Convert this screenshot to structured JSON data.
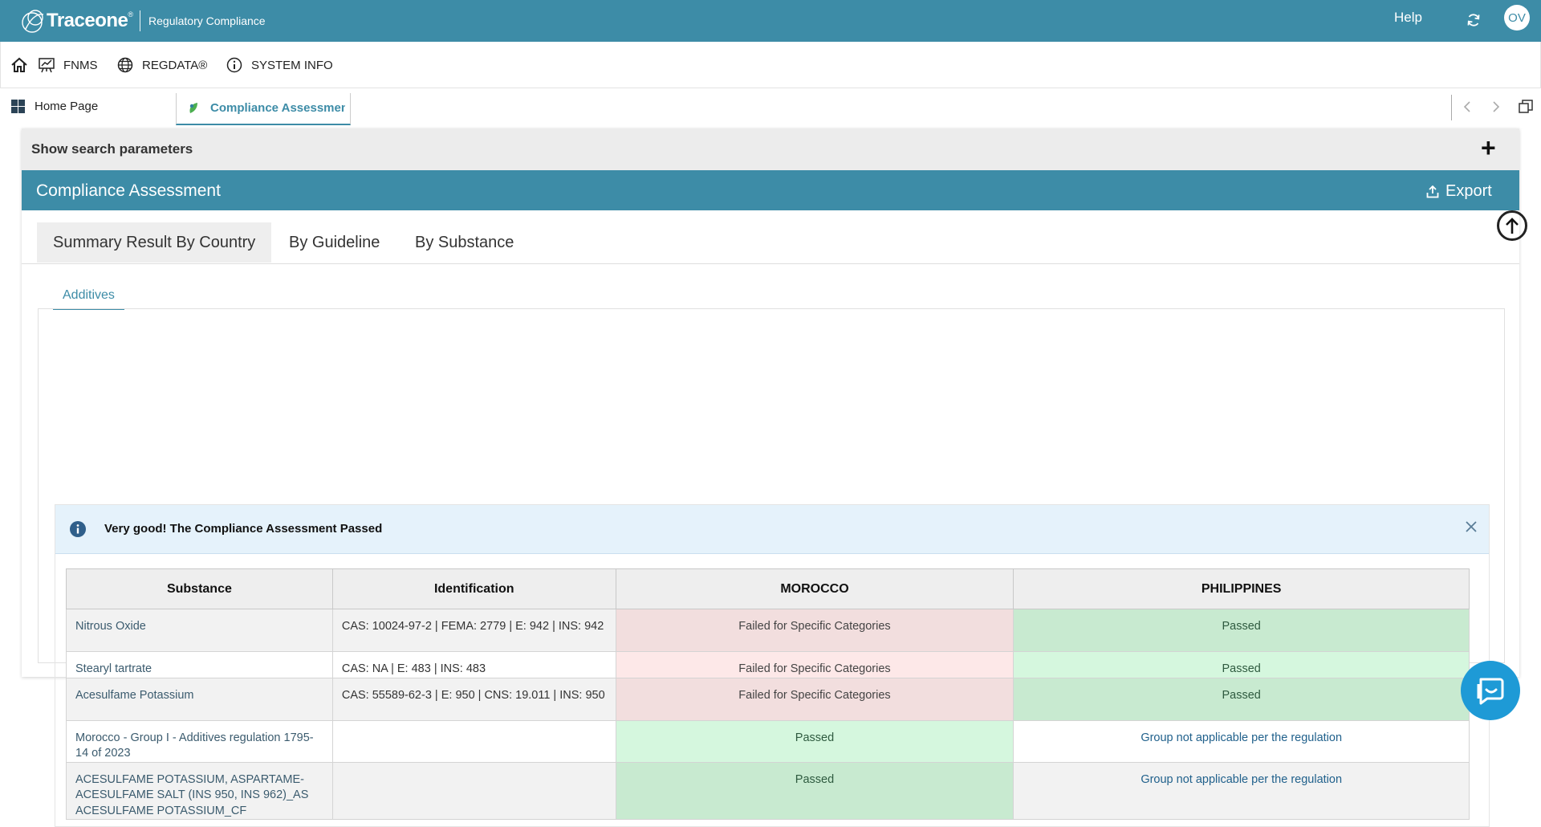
{
  "topbar": {
    "brand": "Traceone",
    "brand_reg": "®",
    "app_name": "Regulatory Compliance",
    "help": "Help",
    "avatar": "OV",
    "bg_color": "#3d8ca7"
  },
  "nav": {
    "items": [
      {
        "label": "FNMS",
        "icon": "presentation-chart-icon"
      },
      {
        "label": "REGDATA®",
        "icon": "globe-icon"
      },
      {
        "label": "SYSTEM INFO",
        "icon": "info-icon"
      }
    ]
  },
  "tabs_bar": {
    "home": "Home Page",
    "active": "Compliance Assessment"
  },
  "panel": {
    "search_params": "Show search parameters",
    "title": "Compliance Assessment",
    "export": "Export",
    "tabs": [
      "Summary Result By Country",
      "By Guideline",
      "By Substance"
    ],
    "active_tab": "Summary Result By Country",
    "subtab": "Additives",
    "alert": "Very good! The Compliance Assessment Passed"
  },
  "table": {
    "headers": [
      "Substance",
      "Identification",
      "MOROCCO",
      "PHILIPPINES"
    ],
    "rows": [
      {
        "substance": "Nitrous Oxide",
        "identification": "CAS: 10024-97-2 | FEMA: 2779 | E: 942 | INS: 942",
        "morocco": "Failed for Specific Categories",
        "philippines": "Passed"
      },
      {
        "substance": "Stearyl tartrate",
        "identification": "CAS: NA | E: 483 | INS: 483",
        "morocco": "Failed for Specific Categories",
        "philippines": "Passed"
      },
      {
        "substance": "Acesulfame Potassium",
        "identification": "CAS: 55589-62-3 | E: 950 | CNS: 19.011 | INS: 950",
        "morocco": "Failed for Specific Categories",
        "philippines": "Passed"
      },
      {
        "substance": "Morocco - Group I - Additives regulation 1795-14 of 2023",
        "identification": "",
        "morocco": "Passed",
        "philippines": "Group not applicable per the regulation"
      },
      {
        "substance": "ACESULFAME POTASSIUM, ASPARTAME-ACESULFAME SALT (INS 950, INS 962)_AS ACESULFAME POTASSIUM_CF",
        "identification": "",
        "morocco": "Passed",
        "philippines": "Group not applicable per the regulation"
      }
    ]
  },
  "colors": {
    "accent": "#3d8ca7",
    "failed": "#f2dede",
    "passed": "#c8ead0",
    "link": "#21618c",
    "chat": "#1e9ad6"
  }
}
